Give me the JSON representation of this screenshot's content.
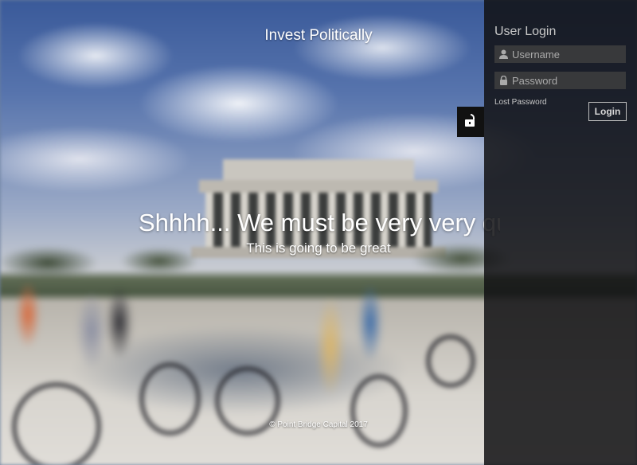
{
  "site": {
    "brand": "Invest Politically",
    "hero_title": "Shhhh... We must be very very quiet",
    "hero_subtitle": "This is going to be great",
    "footer": "© Point Bridge Capital 2017"
  },
  "login_panel": {
    "title": "User Login",
    "username_placeholder": "Username",
    "password_placeholder": "Password",
    "lost_password": "Lost Password",
    "login_button": "Login",
    "toggle_icon": "unlock-icon",
    "user_icon": "user-icon",
    "lock_icon": "lock-icon"
  },
  "colors": {
    "panel_bg": "#121214",
    "field_bg": "#38393b",
    "text": "#ffffff"
  }
}
